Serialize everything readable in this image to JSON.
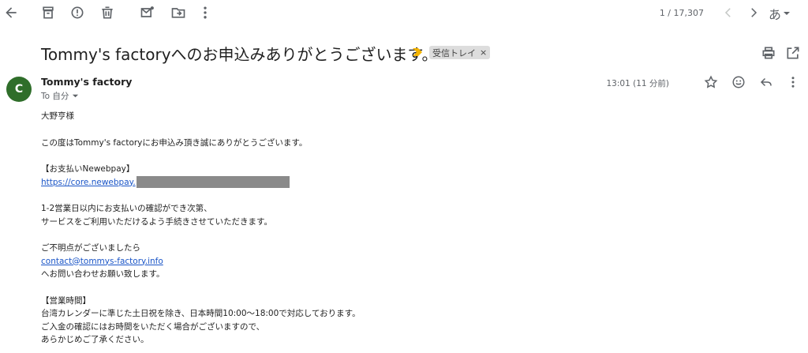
{
  "toolbar": {
    "back_icon": "arrow-left-icon",
    "archive_icon": "archive-icon",
    "spam_icon": "report-spam-icon",
    "delete_icon": "trash-icon",
    "mark_unread_icon": "mark-unread-icon",
    "move_icon": "move-to-folder-icon",
    "more_icon": "more-vert-icon",
    "pager": "1 / 17,307",
    "lang": "あ"
  },
  "email": {
    "subject": "Tommy's factoryへのお申込みありがとうございます。",
    "label": "受信トレイ",
    "label_close": "×",
    "sender_avatar": "C",
    "sender_name": "Tommy's factory",
    "recipient": "To 自分",
    "timestamp": "13:01 (11 分前)"
  },
  "body": {
    "greeting": "大野亨様",
    "line1": "この度はTommy's factoryにお申込み頂き誠にありがとうございます。",
    "pay_heading": "【お支払いNewebpay】",
    "pay_link": "https://core.newebpay.",
    "notice1": "1-2営業日以内にお支払いの確認ができ次第、",
    "notice2": "サービスをご利用いただけるよう手続きさせていただきます。",
    "contact1": "ご不明点がございましたら",
    "contact_email": "contact@tommys-factory.info",
    "contact2": "へお問い合わせお願い致します。",
    "hours_heading": "【営業時間】",
    "hours1": "台湾カレンダーに準じた土日祝を除き、日本時間10:00〜18:00で対応しております。",
    "hours2": "ご入金の確認にはお時間をいただく場合がございますので、",
    "hours3": "あらかじめご了承ください。"
  },
  "colors": {
    "avatar": "#2f6e2a",
    "link": "#1a55c7",
    "importance_marker": "#f4b400"
  }
}
